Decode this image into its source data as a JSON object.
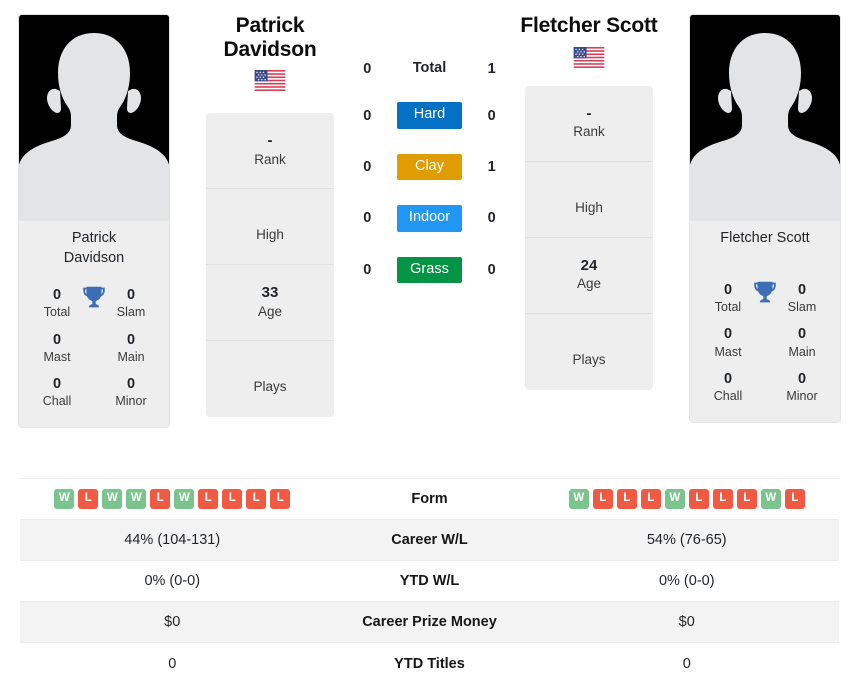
{
  "players": {
    "left": {
      "name": "Patrick Davidson",
      "name_line1": "Patrick",
      "name_line2": "Davidson",
      "card_name_line1": "Patrick",
      "card_name_line2": "Davidson",
      "flag": "us-flag",
      "rank": "-",
      "rank_label": "Rank",
      "high": "",
      "high_label": "High",
      "age": "33",
      "age_label": "Age",
      "plays": "",
      "plays_label": "Plays",
      "titles": {
        "total": "0",
        "total_label": "Total",
        "slam": "0",
        "slam_label": "Slam",
        "mast": "0",
        "mast_label": "Mast",
        "main": "0",
        "main_label": "Main",
        "chall": "0",
        "chall_label": "Chall",
        "minor": "0",
        "minor_label": "Minor"
      },
      "h2h": {
        "total": "0",
        "hard": "0",
        "clay": "0",
        "indoor": "0",
        "grass": "0"
      },
      "form": [
        "W",
        "L",
        "W",
        "W",
        "L",
        "W",
        "L",
        "L",
        "L",
        "L"
      ],
      "career_wl": "44% (104-131)",
      "ytd_wl": "0% (0-0)",
      "career_prize": "$0",
      "ytd_titles": "0"
    },
    "right": {
      "name": "Fletcher Scott",
      "name_line1": "Fletcher Scott",
      "card_name_line1": "Fletcher Scott",
      "flag": "us-flag",
      "rank": "-",
      "rank_label": "Rank",
      "high": "",
      "high_label": "High",
      "age": "24",
      "age_label": "Age",
      "plays": "",
      "plays_label": "Plays",
      "titles": {
        "total": "0",
        "total_label": "Total",
        "slam": "0",
        "slam_label": "Slam",
        "mast": "0",
        "mast_label": "Mast",
        "main": "0",
        "main_label": "Main",
        "chall": "0",
        "chall_label": "Chall",
        "minor": "0",
        "minor_label": "Minor"
      },
      "h2h": {
        "total": "1",
        "hard": "0",
        "clay": "1",
        "indoor": "0",
        "grass": "0"
      },
      "form": [
        "W",
        "L",
        "L",
        "L",
        "W",
        "L",
        "L",
        "L",
        "W",
        "L"
      ],
      "career_wl": "54% (76-65)",
      "ytd_wl": "0% (0-0)",
      "career_prize": "$0",
      "ytd_titles": "0"
    }
  },
  "surfaces": [
    {
      "key": "total",
      "label": "Total",
      "color": "transparent",
      "plain": true
    },
    {
      "key": "hard",
      "label": "Hard",
      "color": "#0571c4",
      "plain": false
    },
    {
      "key": "clay",
      "label": "Clay",
      "color": "#e09c00",
      "plain": false
    },
    {
      "key": "indoor",
      "label": "Indoor",
      "color": "#2196f3",
      "plain": false
    },
    {
      "key": "grass",
      "label": "Grass",
      "color": "#039445",
      "plain": false
    }
  ],
  "table_rows": [
    {
      "label": "Form",
      "kind": "form"
    },
    {
      "label": "Career W/L",
      "kind": "text",
      "left": "44% (104-131)",
      "right": "54% (76-65)"
    },
    {
      "label": "YTD W/L",
      "kind": "text",
      "left": "0% (0-0)",
      "right": "0% (0-0)"
    },
    {
      "label": "Career Prize Money",
      "kind": "text",
      "left": "$0",
      "right": "$0"
    },
    {
      "label": "YTD Titles",
      "kind": "text",
      "left": "0",
      "right": "0"
    }
  ],
  "colors": {
    "win_badge": "#7cc48d",
    "loss_badge": "#f05a43",
    "trophy": "#3b6eb4",
    "panel_bg": "#eeeeee",
    "row_alt": "#f3f3f3"
  }
}
